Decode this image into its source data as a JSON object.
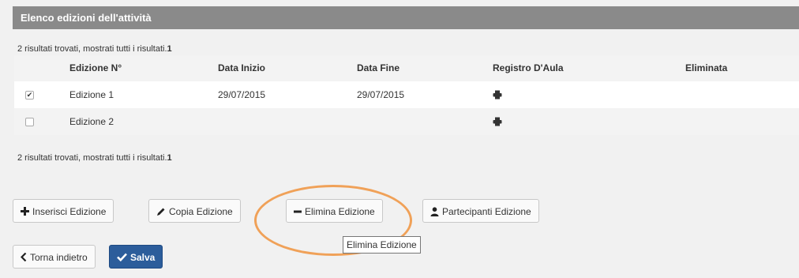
{
  "panel": {
    "title": "Elenco edizioni dell'attività"
  },
  "results": {
    "text": "2 risultati trovati, mostrati tutti i risultati.",
    "page": "1"
  },
  "table": {
    "headers": [
      "Edizione N°",
      "Data Inizio",
      "Data Fine",
      "Registro D'Aula",
      "Eliminata"
    ],
    "rows": [
      {
        "checked": true,
        "edition": "Edizione 1",
        "start": "29/07/2015",
        "end": "29/07/2015",
        "register_icon": "printer-icon",
        "deleted": ""
      },
      {
        "checked": false,
        "edition": "Edizione 2",
        "start": "",
        "end": "",
        "register_icon": "printer-icon",
        "deleted": ""
      }
    ]
  },
  "buttons": {
    "insert": "Inserisci Edizione",
    "copy": "Copia Edizione",
    "delete": "Elimina Edizione",
    "participants": "Partecipanti Edizione",
    "back": "Torna indietro",
    "save": "Salva"
  },
  "tooltip": {
    "text": "Elimina Edizione"
  },
  "colors": {
    "header_bg": "#8a8a8a",
    "primary": "#2c5d9b",
    "annotation": "#f0a158"
  },
  "icons": {
    "insert": "plus-icon",
    "copy": "pencil-icon",
    "delete": "minus-icon",
    "participants": "user-icon",
    "back": "chevron-left-icon",
    "save": "check-icon"
  }
}
